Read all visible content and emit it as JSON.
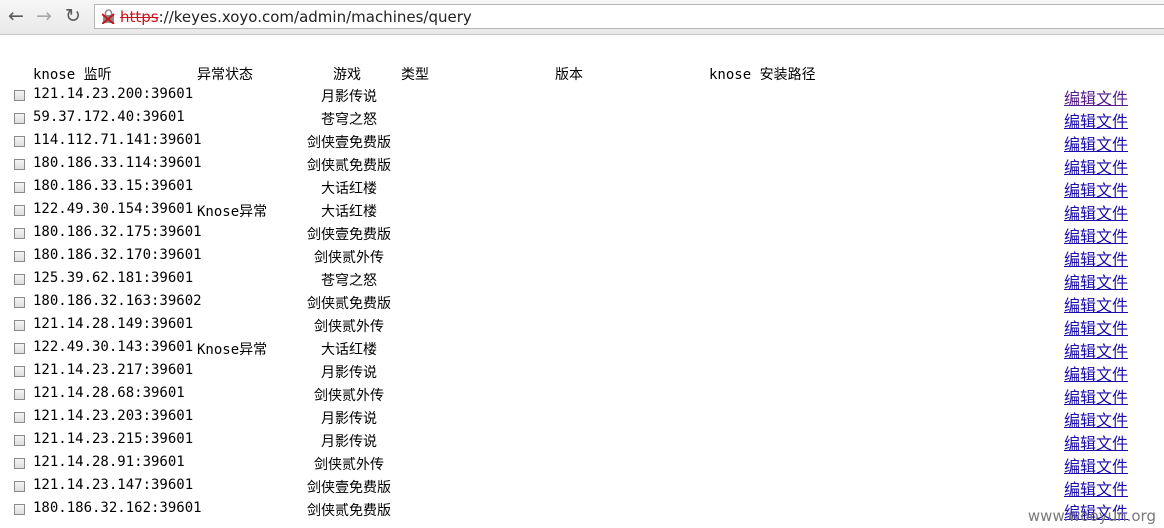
{
  "browser": {
    "back_icon": "arrow-left-icon",
    "forward_icon": "arrow-right-icon",
    "reload_icon": "reload-icon",
    "url_protocol": "https",
    "url_rest": "://keyes.xoyo.com/admin/machines/query"
  },
  "table": {
    "headers": {
      "listen": "knose 监听",
      "status": "异常状态",
      "game": "游戏",
      "type": "类型",
      "version": "版本",
      "path": "knose 安装路径"
    },
    "rows": [
      {
        "ip": "121.14.23.200:39601",
        "status": "",
        "game": "月影传说",
        "action": "编辑文件"
      },
      {
        "ip": "59.37.172.40:39601",
        "status": "",
        "game": "苍穹之怒",
        "action": "编辑文件"
      },
      {
        "ip": "114.112.71.141:39601",
        "status": "",
        "game": "剑侠壹免费版",
        "action": "编辑文件"
      },
      {
        "ip": "180.186.33.114:39601",
        "status": "",
        "game": "剑侠贰免费版",
        "action": "编辑文件"
      },
      {
        "ip": "180.186.33.15:39601",
        "status": "",
        "game": "大话红楼",
        "action": "编辑文件"
      },
      {
        "ip": "122.49.30.154:39601",
        "status": "Knose异常",
        "game": "大话红楼",
        "action": "编辑文件"
      },
      {
        "ip": "180.186.32.175:39601",
        "status": "",
        "game": "剑侠壹免费版",
        "action": "编辑文件"
      },
      {
        "ip": "180.186.32.170:39601",
        "status": "",
        "game": "剑侠贰外传",
        "action": "编辑文件"
      },
      {
        "ip": "125.39.62.181:39601",
        "status": "",
        "game": "苍穹之怒",
        "action": "编辑文件"
      },
      {
        "ip": "180.186.32.163:39602",
        "status": "",
        "game": "剑侠贰免费版",
        "action": "编辑文件"
      },
      {
        "ip": "121.14.28.149:39601",
        "status": "",
        "game": "剑侠贰外传",
        "action": "编辑文件"
      },
      {
        "ip": "122.49.30.143:39601",
        "status": "Knose异常",
        "game": "大话红楼",
        "action": "编辑文件"
      },
      {
        "ip": "121.14.23.217:39601",
        "status": "",
        "game": "月影传说",
        "action": "编辑文件"
      },
      {
        "ip": "121.14.28.68:39601",
        "status": "",
        "game": "剑侠贰外传",
        "action": "编辑文件"
      },
      {
        "ip": "121.14.23.203:39601",
        "status": "",
        "game": "月影传说",
        "action": "编辑文件"
      },
      {
        "ip": "121.14.23.215:39601",
        "status": "",
        "game": "月影传说",
        "action": "编辑文件"
      },
      {
        "ip": "121.14.28.91:39601",
        "status": "",
        "game": "剑侠贰外传",
        "action": "编辑文件"
      },
      {
        "ip": "121.14.23.147:39601",
        "status": "",
        "game": "剑侠壹免费版",
        "action": "编辑文件"
      },
      {
        "ip": "180.186.32.162:39601",
        "status": "",
        "game": "剑侠贰免费版",
        "action": "编辑文件"
      }
    ]
  },
  "watermark": "www.wooyun.org",
  "colors": {
    "link": "#1a0dab",
    "visited_link": "#551a8b",
    "insecure": "#c8141c"
  }
}
